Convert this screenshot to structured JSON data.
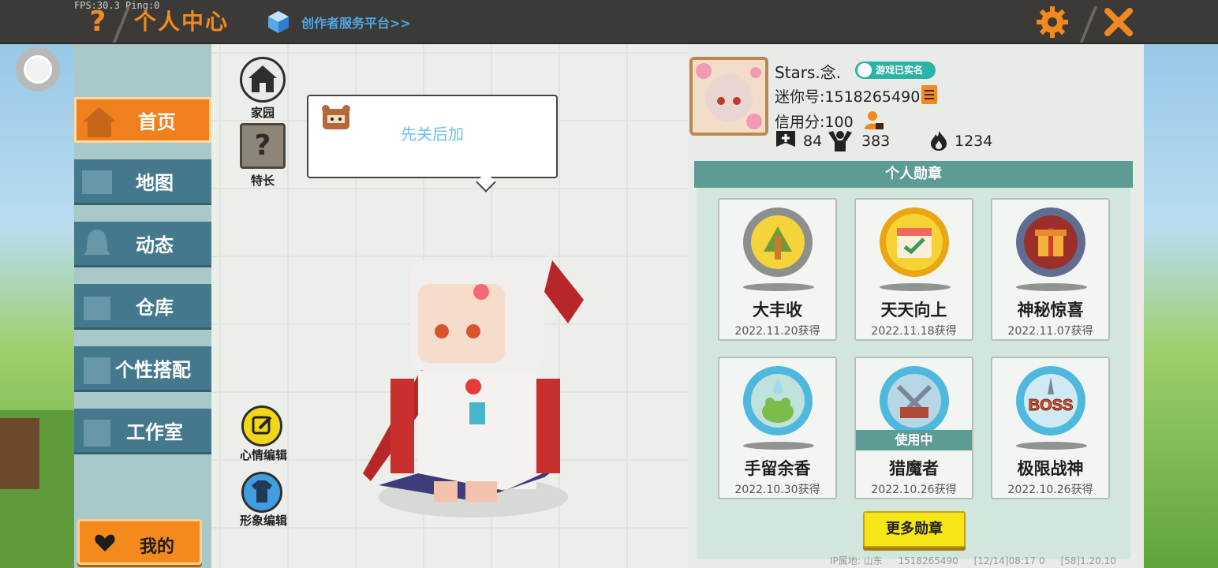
{
  "topbar": {
    "fps_text": "FPS:30.3  Ping:0",
    "title": "个人中心",
    "creator_link": "创作者服务平台>>"
  },
  "sidebar": {
    "items": [
      {
        "label": "首页",
        "icon": "home-icon",
        "active": true
      },
      {
        "label": "地图",
        "icon": "map-icon",
        "active": false
      },
      {
        "label": "动态",
        "icon": "bell-icon",
        "active": false
      },
      {
        "label": "仓库",
        "icon": "warehouse-icon",
        "active": false
      },
      {
        "label": "个性搭配",
        "icon": "outfit-icon",
        "active": false
      },
      {
        "label": "工作室",
        "icon": "studio-icon",
        "active": false
      }
    ],
    "mine_label": "我的"
  },
  "character_area": {
    "home_label": "家园",
    "talent_label": "特长",
    "talent_symbol": "?",
    "bubble_text": "先关后加",
    "mood_edit_label": "心情编辑",
    "look_edit_label": "形象编辑"
  },
  "profile": {
    "username": "Stars.念.",
    "verified_label": "游戏已实名",
    "mini_id": "迷你号:1518265490",
    "credit": "信用分:100",
    "stats": {
      "likes": "84",
      "fans": "383",
      "popularity": "1234"
    }
  },
  "medals": {
    "header": "个人勋章",
    "items": [
      {
        "name": "大丰收",
        "date": "2022.11.20获得",
        "icon": "harvest-medal-icon",
        "in_use": false
      },
      {
        "name": "天天向上",
        "date": "2022.11.18获得",
        "icon": "calendar-medal-icon",
        "in_use": false
      },
      {
        "name": "神秘惊喜",
        "date": "2022.11.07获得",
        "icon": "gift-medal-icon",
        "in_use": false
      },
      {
        "name": "手留余香",
        "date": "2022.10.30获得",
        "icon": "frog-medal-icon",
        "in_use": false
      },
      {
        "name": "猎魔者",
        "date": "2022.10.26获得",
        "icon": "swords-medal-icon",
        "in_use": true
      },
      {
        "name": "极限战神",
        "date": "2022.10.26获得",
        "icon": "boss-medal-icon",
        "in_use": false
      }
    ],
    "in_use_label": "使用中",
    "boss_text": "BOSS",
    "more_button": "更多勋章"
  },
  "footer": {
    "ip_location": "IP属地: 山东",
    "uid": "1518265490",
    "time": "[12/14]08:17 0",
    "version": "[58]1.20.10"
  },
  "colors": {
    "accent_orange": "#f07f1e",
    "nav_teal": "#44788d",
    "medal_teal": "#5d9b95",
    "more_yellow": "#f6e517"
  }
}
